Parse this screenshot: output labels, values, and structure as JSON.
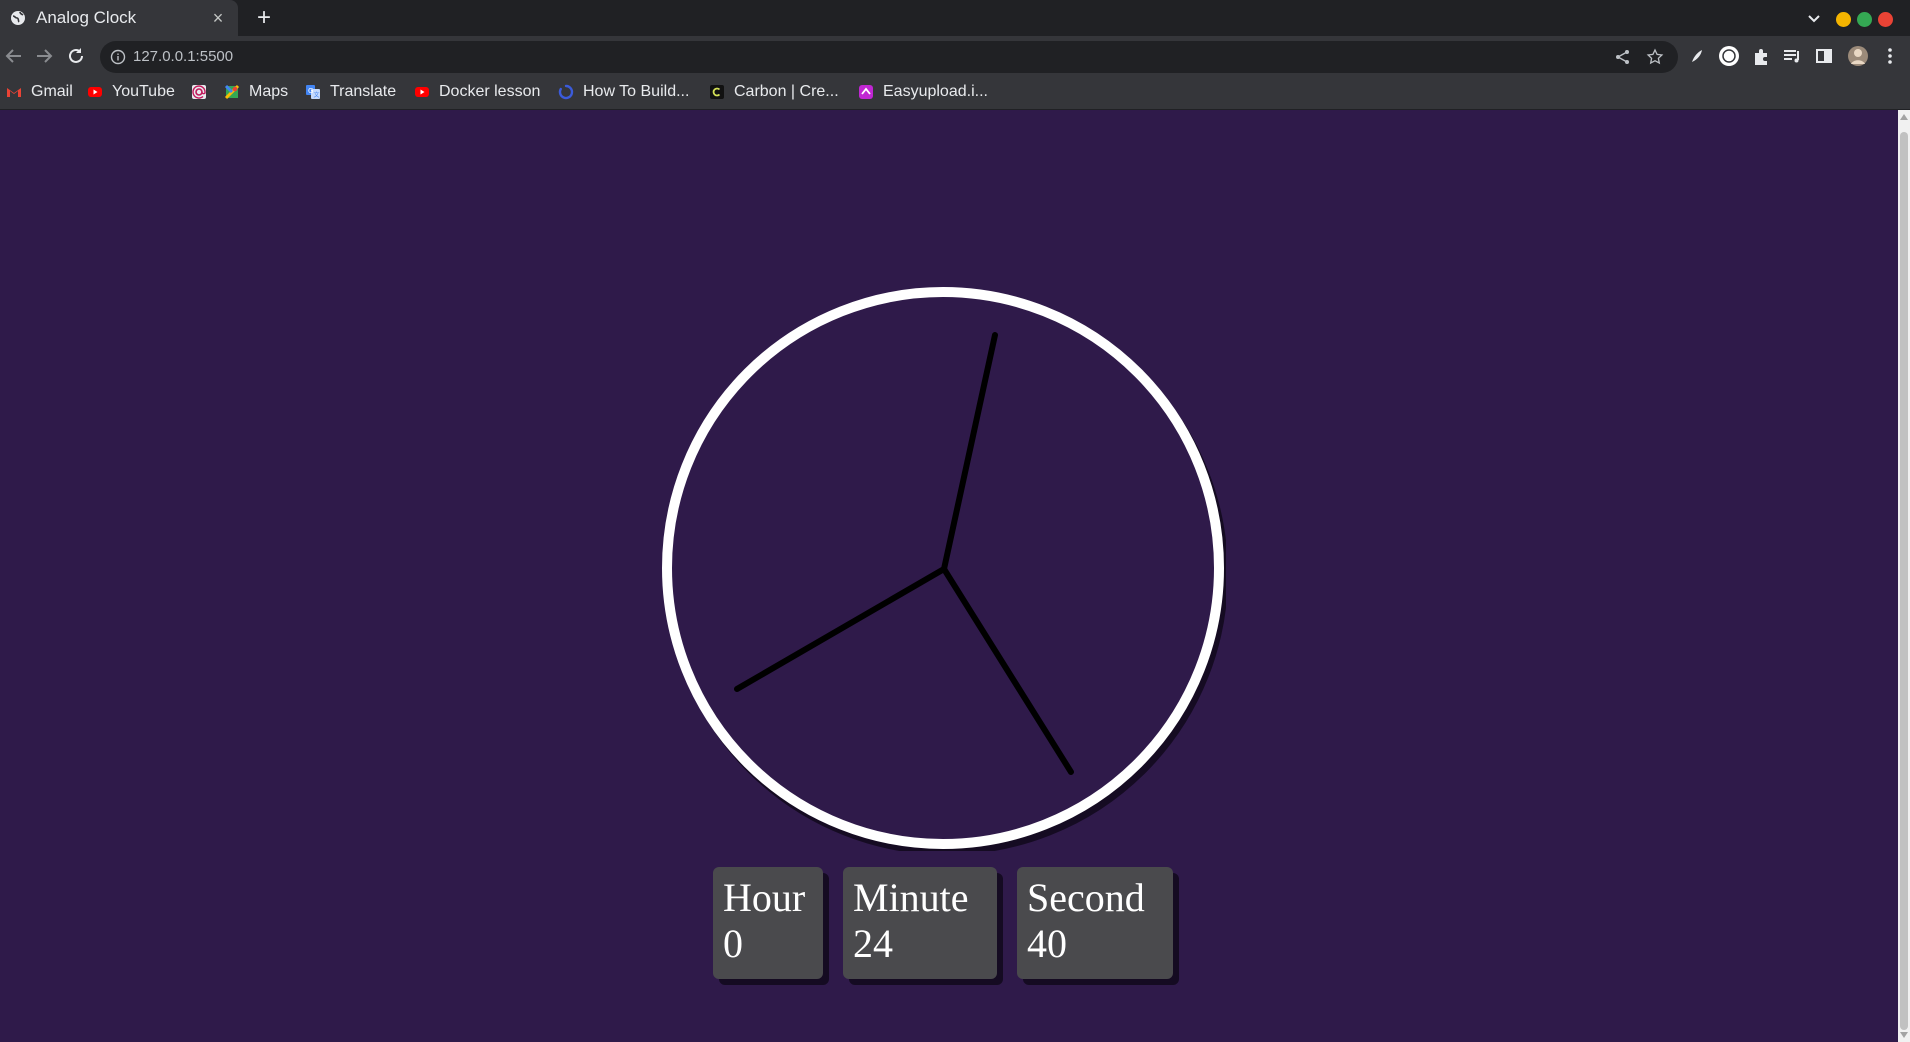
{
  "browser": {
    "tab_title": "Analog Clock",
    "tab_close": "×",
    "new_tab": "+",
    "url": "127.0.0.1:5500",
    "bookmarks": [
      {
        "label": "Gmail",
        "icon": "gmail-icon",
        "color": "#ea4335"
      },
      {
        "label": "YouTube",
        "icon": "youtube-icon",
        "color": "#ff0000"
      },
      {
        "label": "",
        "icon": "at-icon",
        "color": "#e8eaed"
      },
      {
        "label": "Maps",
        "icon": "maps-icon",
        "color": "#34a853"
      },
      {
        "label": "Translate",
        "icon": "translate-icon",
        "color": "#8ab4f8"
      },
      {
        "label": "Docker lesson",
        "icon": "youtube-icon",
        "color": "#ff0000"
      },
      {
        "label": "How To Build...",
        "icon": "loader-icon",
        "color": "#3b5bdb"
      },
      {
        "label": "Carbon | Cre...",
        "icon": "carbon-icon",
        "color": "#d4e157"
      },
      {
        "label": "Easyupload.i...",
        "icon": "easyupload-icon",
        "color": "#c026d3"
      }
    ],
    "window_controls": {
      "minimize": "#f4b400",
      "maximize": "#34a853",
      "close": "#ea4335"
    }
  },
  "page": {
    "background": "#2f1a4a",
    "clock": {
      "face_color": "#2f1a4a",
      "border_color": "#ffffff",
      "hand_color": "#000000"
    },
    "time": {
      "hour_label": "Hour",
      "hour_value": "0",
      "minute_label": "Minute",
      "minute_value": "24",
      "second_label": "Second",
      "second_value": "40"
    }
  }
}
